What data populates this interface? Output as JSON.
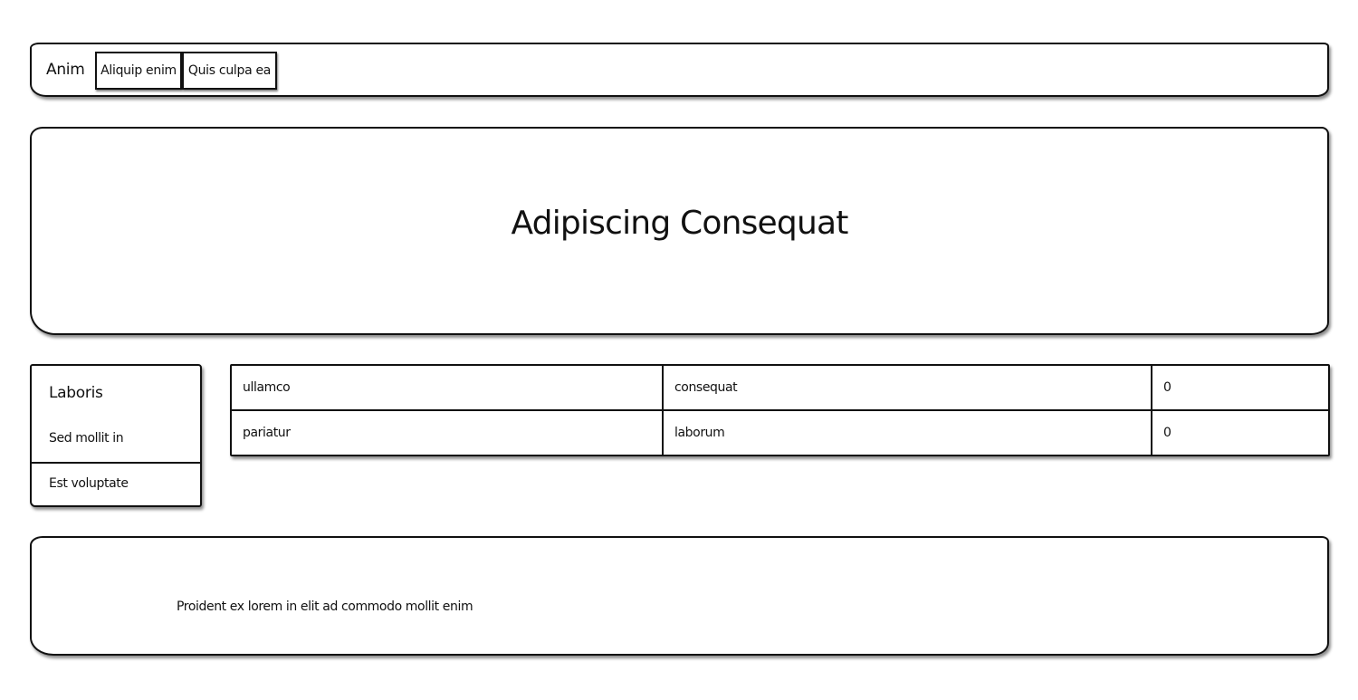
{
  "navbar": {
    "brand": "Anim",
    "buttons": [
      "Aliquip enim",
      "Quis culpa ea"
    ]
  },
  "hero": {
    "title": "Adipiscing Consequat"
  },
  "sidebar": {
    "heading": "Laboris",
    "items": [
      "Sed mollit in",
      "Est voluptate"
    ]
  },
  "table": {
    "rows": [
      [
        "ullamco",
        "consequat",
        "0"
      ],
      [
        "pariatur",
        "laborum",
        "0"
      ]
    ]
  },
  "footer": {
    "text": "Proident ex lorem in elit ad commodo mollit enim"
  }
}
